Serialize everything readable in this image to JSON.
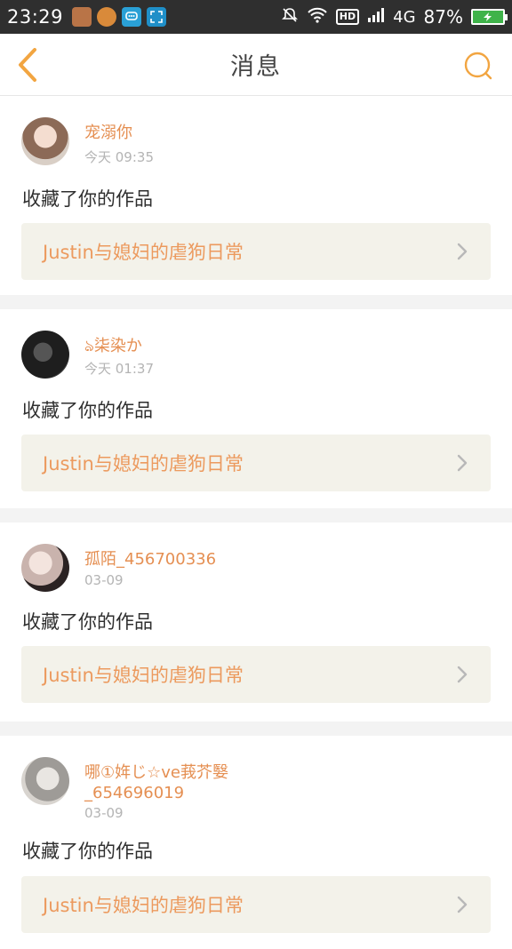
{
  "status_bar": {
    "time": "23:29",
    "network": "4G",
    "battery_percent": "87%",
    "hd_label": "HD",
    "app_icons": [
      "app-icon-1",
      "app-icon-2",
      "message-app-icon",
      "screenshot-app-icon"
    ]
  },
  "header": {
    "title": "消息",
    "back_icon": "chevron-left-icon",
    "search_icon": "search-icon",
    "accent_color": "#f2a541"
  },
  "messages": [
    {
      "username": "宠溺你",
      "time": "今天 09:35",
      "action": "收藏了你的作品",
      "work_title": "Justin与媳妇的虐狗日常"
    },
    {
      "username": "ঌ柒染か",
      "time": "今天 01:37",
      "action": "收藏了你的作品",
      "work_title": "Justin与媳妇的虐狗日常"
    },
    {
      "username": "孤陌_456700336",
      "time": "03-09",
      "action": "收藏了你的作品",
      "work_title": "Justin与媳妇的虐狗日常"
    },
    {
      "username": "哪①姩じ☆ve莪芥嫛_654696019",
      "time": "03-09",
      "action": "收藏了你的作品",
      "work_title": "Justin与媳妇的虐狗日常"
    }
  ],
  "colors": {
    "username": "#e58f52",
    "work_title": "#ec9a5e",
    "work_bg": "#f3f2ea",
    "status_bar_bg": "#2f2f2f"
  }
}
